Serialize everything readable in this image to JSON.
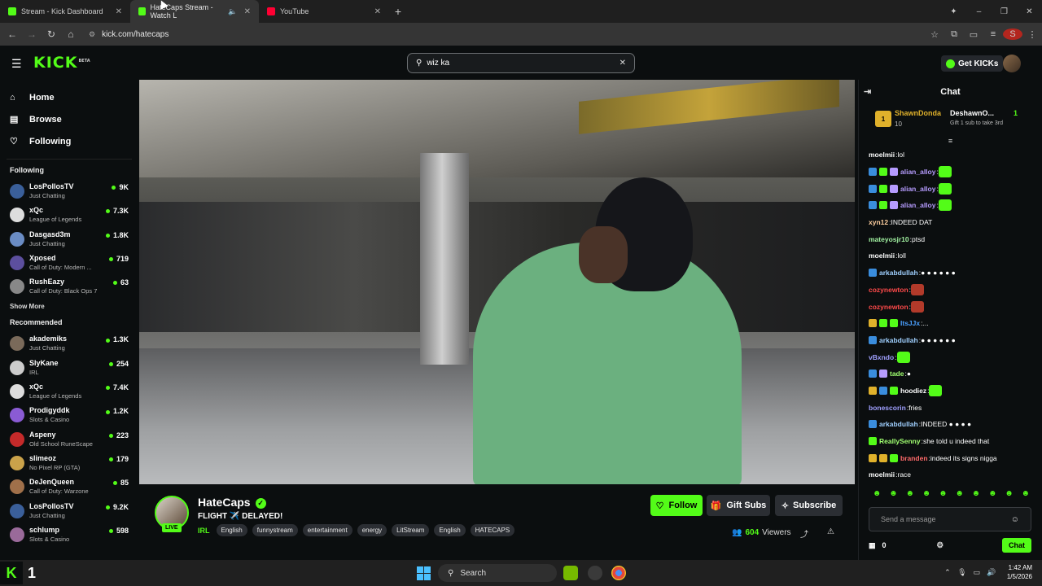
{
  "browser": {
    "tabs": [
      {
        "title": "Stream - Kick Dashboard",
        "active": false
      },
      {
        "title": "HateCaps Stream - Watch L",
        "active": true
      },
      {
        "title": "YouTube",
        "active": false
      }
    ],
    "url": "kick.com/hatecaps",
    "profile_initial": "S"
  },
  "header": {
    "logo": "KICK",
    "logo_badge": "BETA",
    "search_value": "wiz ka",
    "get_kicks_label": "Get KICKs"
  },
  "sidebar": {
    "nav": [
      {
        "label": "Home",
        "icon": "home-icon"
      },
      {
        "label": "Browse",
        "icon": "browse-icon"
      },
      {
        "label": "Following",
        "icon": "heart-icon"
      }
    ],
    "following_title": "Following",
    "following": [
      {
        "name": "LosPollosTV",
        "category": "Just Chatting",
        "viewers": "9K",
        "color": "#3a5f9a"
      },
      {
        "name": "xQc",
        "category": "League of Legends",
        "viewers": "7.3K",
        "color": "#dddddd"
      },
      {
        "name": "Dasgasd3m",
        "category": "Just Chatting",
        "viewers": "1.8K",
        "color": "#6a8cc4"
      },
      {
        "name": "Xposed",
        "category": "Call of Duty: Modern ...",
        "viewers": "719",
        "color": "#5c4f9e"
      },
      {
        "name": "RushEazy",
        "category": "Call of Duty: Black Ops 7",
        "viewers": "63",
        "color": "#888888"
      }
    ],
    "show_more": "Show More",
    "recommended_title": "Recommended",
    "recommended": [
      {
        "name": "akademiks",
        "category": "Just Chatting",
        "viewers": "1.3K",
        "color": "#7a6a5a"
      },
      {
        "name": "SlyKane",
        "category": "IRL",
        "viewers": "254",
        "color": "#cccccc"
      },
      {
        "name": "xQc",
        "category": "League of Legends",
        "viewers": "7.4K",
        "color": "#dddddd"
      },
      {
        "name": "Prodigyddk",
        "category": "Slots & Casino",
        "viewers": "1.2K",
        "color": "#8a5bd4"
      },
      {
        "name": "Aspeny",
        "category": "Old School RuneScape",
        "viewers": "223",
        "color": "#c42a2a"
      },
      {
        "name": "slimeoz",
        "category": "No Pixel RP (GTA)",
        "viewers": "179",
        "color": "#caa24a"
      },
      {
        "name": "DeJenQueen",
        "category": "Call of Duty: Warzone",
        "viewers": "85",
        "color": "#a0704a"
      },
      {
        "name": "LosPollosTV",
        "category": "Just Chatting",
        "viewers": "9.2K",
        "color": "#3a5f9a"
      },
      {
        "name": "schlump",
        "category": "Slots & Casino",
        "viewers": "598",
        "color": "#9a6a9a"
      }
    ]
  },
  "stream": {
    "channel": "HateCaps",
    "live_label": "LIVE",
    "title": "FLIGHT ✈️ DELAYED!",
    "category": "IRL",
    "tags": [
      "English",
      "funnystream",
      "entertainment",
      "energy",
      "LitStream",
      "English",
      "HATECAPS"
    ],
    "follow_label": "Follow",
    "gift_label": "Gift Subs",
    "subscribe_label": "Subscribe",
    "viewers": "604",
    "viewers_label": "Viewers"
  },
  "chat": {
    "title": "Chat",
    "pinned": {
      "rank": "1",
      "top_gifter": "ShawnDonda",
      "top_gifter_count": "10",
      "second": "DeshawnO...",
      "second_count": "1",
      "second_caption": "Gift 1 sub to take 3rd"
    },
    "messages": [
      {
        "user": "moelmii",
        "text": "lol",
        "color": "#ffffff",
        "badges": []
      },
      {
        "user": "alian_alloy",
        "text": "",
        "color": "#b69cff",
        "badges": [
          "#3a8ddd",
          "#53fc18",
          "#b69cff"
        ],
        "emote": true
      },
      {
        "user": "alian_alloy",
        "text": "",
        "color": "#b69cff",
        "badges": [
          "#3a8ddd",
          "#53fc18",
          "#b69cff"
        ],
        "emote": true
      },
      {
        "user": "alian_alloy",
        "text": "",
        "color": "#b69cff",
        "badges": [
          "#3a8ddd",
          "#53fc18",
          "#b69cff"
        ],
        "emote": true
      },
      {
        "user": "xyn12",
        "text": "INDEED DAT",
        "color": "#ffd0a0",
        "badges": []
      },
      {
        "user": "mateyosjr10",
        "text": "ptsd",
        "color": "#a0f0a0",
        "badges": []
      },
      {
        "user": "moelmii",
        "text": "loll",
        "color": "#ffffff",
        "badges": []
      },
      {
        "user": "arkabdullah",
        "text": "● ● ● ● ● ●",
        "color": "#a0d0ff",
        "badges": [
          "#3a8ddd"
        ]
      },
      {
        "user": "cozynewton",
        "text": "",
        "color": "#ff4a4a",
        "badges": [],
        "emote": true
      },
      {
        "user": "cozynewton",
        "text": "",
        "color": "#ff4a4a",
        "badges": [],
        "emote": true
      },
      {
        "user": "ItsJJx",
        "text": "...",
        "color": "#4aa0ff",
        "badges": [
          "#e0b12b",
          "#53fc18",
          "#53fc18"
        ]
      },
      {
        "user": "arkabdullah",
        "text": "● ● ● ● ● ●",
        "color": "#a0d0ff",
        "badges": [
          "#3a8ddd"
        ]
      },
      {
        "user": "vBxndo",
        "text": "",
        "color": "#a0a0ff",
        "badges": [],
        "emote": true
      },
      {
        "user": "tade",
        "text": "●",
        "color": "#a0ff70",
        "badges": [
          "#3a8ddd",
          "#b69cff"
        ]
      },
      {
        "user": "hoodiez",
        "text": "",
        "color": "#ffffff",
        "badges": [
          "#e0b12b",
          "#3a8ddd",
          "#53fc18"
        ],
        "emote": true
      },
      {
        "user": "bonescorin",
        "text": "fries",
        "color": "#a0a0ff",
        "badges": []
      },
      {
        "user": "arkabdullah",
        "text": "INDEED ● ● ● ●",
        "color": "#a0d0ff",
        "badges": [
          "#3a8ddd"
        ]
      },
      {
        "user": "ReallySenny",
        "text": "she told u indeed that",
        "color": "#a0ff70",
        "badges": [
          "#53fc18"
        ]
      },
      {
        "user": "branden",
        "text": "indeed its signs nigga",
        "color": "#ff6a6a",
        "badges": [
          "#e0b12b",
          "#e0b12b",
          "#53fc18"
        ]
      },
      {
        "user": "moelmii",
        "text": "race",
        "color": "#ffffff",
        "badges": []
      }
    ],
    "input_placeholder": "Send a message",
    "kicks_count": "0",
    "chat_button": "Chat"
  },
  "taskbar": {
    "search_label": "Search",
    "time": "1:42 AM",
    "date": "1/5/2026",
    "kick_count": "1"
  }
}
